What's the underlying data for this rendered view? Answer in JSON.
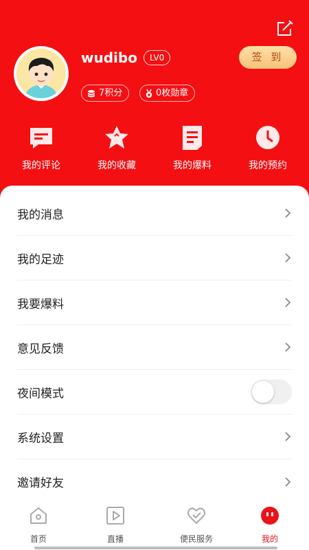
{
  "colors": {
    "brand_red": "#f40f13",
    "checkin_text": "#b34a14",
    "active_tab": "#e8141a"
  },
  "profile": {
    "username": "wudibo",
    "level": "LV0",
    "checkin_label": "签 到",
    "points_label": "7积分",
    "medals_label": "0枚勋章"
  },
  "quick_actions": [
    {
      "label": "我的评论",
      "icon": "comment-icon"
    },
    {
      "label": "我的收藏",
      "icon": "star-icon"
    },
    {
      "label": "我的爆料",
      "icon": "document-icon"
    },
    {
      "label": "我的预约",
      "icon": "clock-icon"
    }
  ],
  "menu": [
    {
      "label": "我的消息",
      "control": "chevron"
    },
    {
      "label": "我的足迹",
      "control": "chevron"
    },
    {
      "label": "我要爆料",
      "control": "chevron"
    },
    {
      "label": "意见反馈",
      "control": "chevron"
    },
    {
      "label": "夜间模式",
      "control": "toggle",
      "toggle_on": false
    },
    {
      "label": "系统设置",
      "control": "chevron"
    },
    {
      "label": "邀请好友",
      "control": "chevron"
    }
  ],
  "tabs": [
    {
      "label": "首页",
      "icon": "home-icon",
      "active": false
    },
    {
      "label": "直播",
      "icon": "play-icon",
      "active": false
    },
    {
      "label": "便民服务",
      "icon": "heart-service-icon",
      "active": false
    },
    {
      "label": "我的",
      "icon": "profile-face-icon",
      "active": true
    }
  ]
}
